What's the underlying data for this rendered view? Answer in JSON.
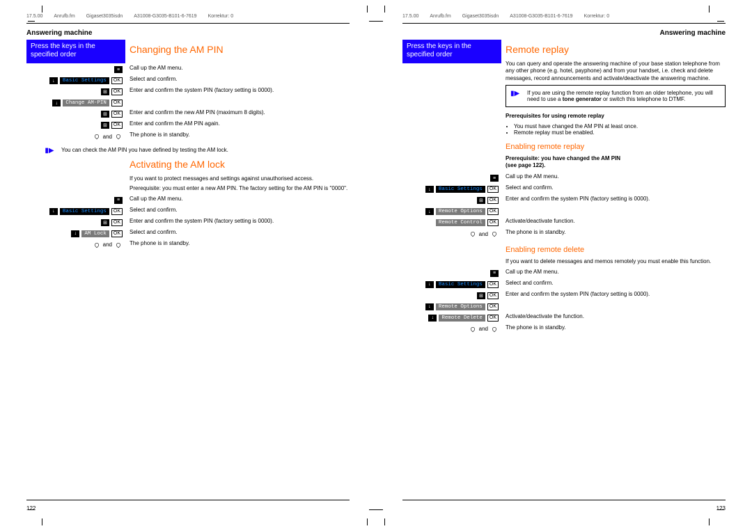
{
  "meta": {
    "date": "17.5.00",
    "file": "Anrufb.fm",
    "model": "Gigaset3035isdn",
    "code": "A31008-G3035-B101-6-7619",
    "korr": "Korrektur: 0"
  },
  "section": "Answering machine",
  "key_instr": "Press the keys in the specified order",
  "ok": "OK",
  "and": " and ",
  "menus": {
    "basic": "Basic Settings",
    "change_pin": "Change AM-PIN",
    "am_lock": "AM Lock",
    "remote_opt": "Remote Options",
    "remote_ctrl": "Remote Control",
    "remote_del": "Remote Delete"
  },
  "left": {
    "h1": "Changing the AM PIN",
    "r1": "Call up the AM menu.",
    "r2": "Select and confirm.",
    "r3": "Enter and confirm the system PIN (factory setting is 0000).",
    "r4": "",
    "r5": "Enter and confirm the new AM PIN (maximum 8 digits).",
    "r6": "Enter and confirm the AM PIN again.",
    "r7": "The phone is in standby.",
    "note1": "You can check the AM PIN you have defined by testing the AM lock.",
    "h2": "Activating the AM lock",
    "p1": "If you want to protect messages and settings against unauthorised access.",
    "p2": "Prerequisite: you must enter a new AM PIN. The factory setting for the AM PIN is \"0000\".",
    "r8": "Call up the AM menu.",
    "r9": "Select and confirm.",
    "r10": "Enter and confirm the system PIN (factory setting is 0000).",
    "r11": "Select and confirm.",
    "r12": "The phone is in standby.",
    "pn": "122"
  },
  "right": {
    "h1": "Remote replay",
    "p1": "You can query and operate the answering machine of your base station telephone from any other phone (e.g. hotel, payphone) and from your handset, i.e. check and delete messages, record announcements and activate/deactivate the answering machine.",
    "note1a": "If you are using the remote replay function from an older telephone, you will need to use a ",
    "note1b": "tone generator",
    "note1c": " or switch this telephone to DTMF.",
    "prereq_h": "Prerequisites for using remote replay",
    "prereq1": "You must have changed the AM PIN at least once.",
    "prereq2": "Remote replay must be enabled.",
    "h2": "Enabling remote replay",
    "p2a": "Prerequisite: you have changed the AM PIN",
    "p2b": "(see page 122).",
    "r1": "Call up the AM menu.",
    "r2": "Select and confirm.",
    "r3": "Enter and confirm the system PIN (factory setting is 0000).",
    "r4": "",
    "r5": "Activate/deactivate function.",
    "r6": "The phone is in standby.",
    "h3": "Enabling remote delete",
    "p3": "If you want to delete messages and memos remotely you must enable this function.",
    "r7": "Call up the AM menu.",
    "r8": "Select and confirm.",
    "r9": "Enter and confirm the system PIN (factory setting is 0000).",
    "r10": "",
    "r11": "Activate/deactivate the function.",
    "r12": "The phone is in standby.",
    "pn": "123"
  }
}
